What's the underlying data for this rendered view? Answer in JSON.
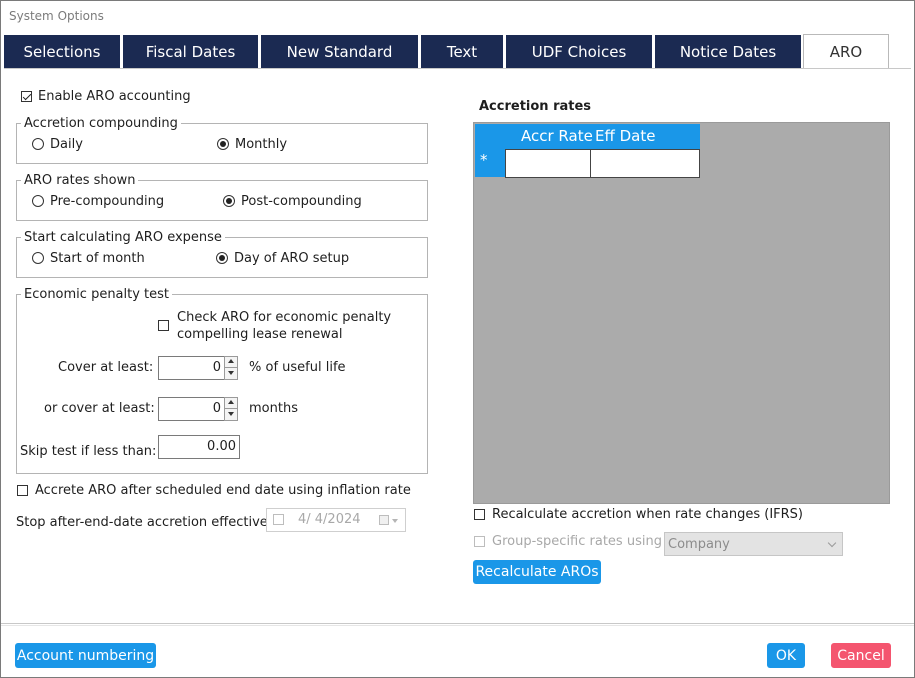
{
  "window": {
    "title": "System Options"
  },
  "tabs": [
    "Selections",
    "Fiscal Dates",
    "New Standard",
    "Text",
    "UDF Choices",
    "Notice Dates",
    "ARO"
  ],
  "active_tab": "ARO",
  "enable_aro": {
    "label": "Enable ARO accounting",
    "checked": true
  },
  "accretion_compounding": {
    "legend": "Accretion compounding",
    "options": [
      "Daily",
      "Monthly"
    ],
    "selected": "Monthly"
  },
  "aro_rates_shown": {
    "legend": "ARO rates shown",
    "options": [
      "Pre-compounding",
      "Post-compounding"
    ],
    "selected": "Post-compounding"
  },
  "start_calculating": {
    "legend": "Start calculating ARO expense",
    "options": [
      "Start of month",
      "Day of ARO setup"
    ],
    "selected": "Day of ARO setup"
  },
  "economic_penalty": {
    "legend": "Economic penalty test",
    "check_label_line1": "Check ARO for economic penalty",
    "check_label_line2": "compelling lease renewal",
    "checked": false,
    "cover_label": "Cover at least:",
    "cover_value": "0",
    "cover_unit": "% of useful life",
    "or_cover_label": "or cover at least:",
    "or_cover_value": "0",
    "or_cover_unit": "months",
    "skip_label": "Skip test if less than:",
    "skip_value": "0.00"
  },
  "accrete_after_end": {
    "label": "Accrete ARO after scheduled end date using inflation rate",
    "checked": false
  },
  "stop_after_end": {
    "label": "Stop after-end-date accretion effective",
    "date": "4/  4/2024"
  },
  "accretion_rates": {
    "title": "Accretion rates",
    "columns": [
      "Accr Rate",
      "Eff Date"
    ],
    "new_row_marker": "*"
  },
  "recalc_when_rate_changes": {
    "label": "Recalculate accretion when rate changes (IFRS)",
    "checked": false
  },
  "group_specific": {
    "label": "Group-specific rates using",
    "checked": false,
    "select_value": "Company"
  },
  "buttons": {
    "recalculate": "Recalculate AROs",
    "account_numbering": "Account numbering",
    "ok": "OK",
    "cancel": "Cancel"
  },
  "colors": {
    "tab_bg": "#1b2a52",
    "accent": "#1a97e8",
    "cancel": "#f4556f",
    "grid_bg": "#ababab"
  }
}
